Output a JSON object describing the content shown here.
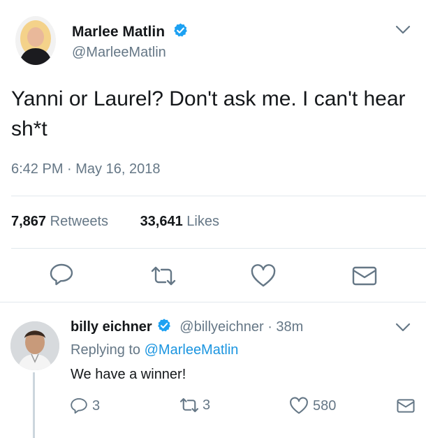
{
  "tweet": {
    "author_name": "Marlee Matlin",
    "author_handle": "@MarleeMatlin",
    "text": "Yanni or Laurel? Don't ask me. I can't hear sh*t",
    "timestamp": "6:42 PM · May 16, 2018",
    "retweets_count": "7,867",
    "retweets_label": "Retweets",
    "likes_count": "33,641",
    "likes_label": "Likes"
  },
  "reply": {
    "author_name": "billy eichner",
    "author_handle": "@billyeichner",
    "time_ago": "· 38m",
    "replying_prefix": "Replying to",
    "replying_to": "@MarleeMatlin",
    "text": "We have a winner!",
    "reply_count": "3",
    "retweet_count": "3",
    "like_count": "580"
  },
  "colors": {
    "verified": "#1da1f2",
    "link": "#1b95e0",
    "muted": "#657786",
    "icon": "#657786"
  }
}
